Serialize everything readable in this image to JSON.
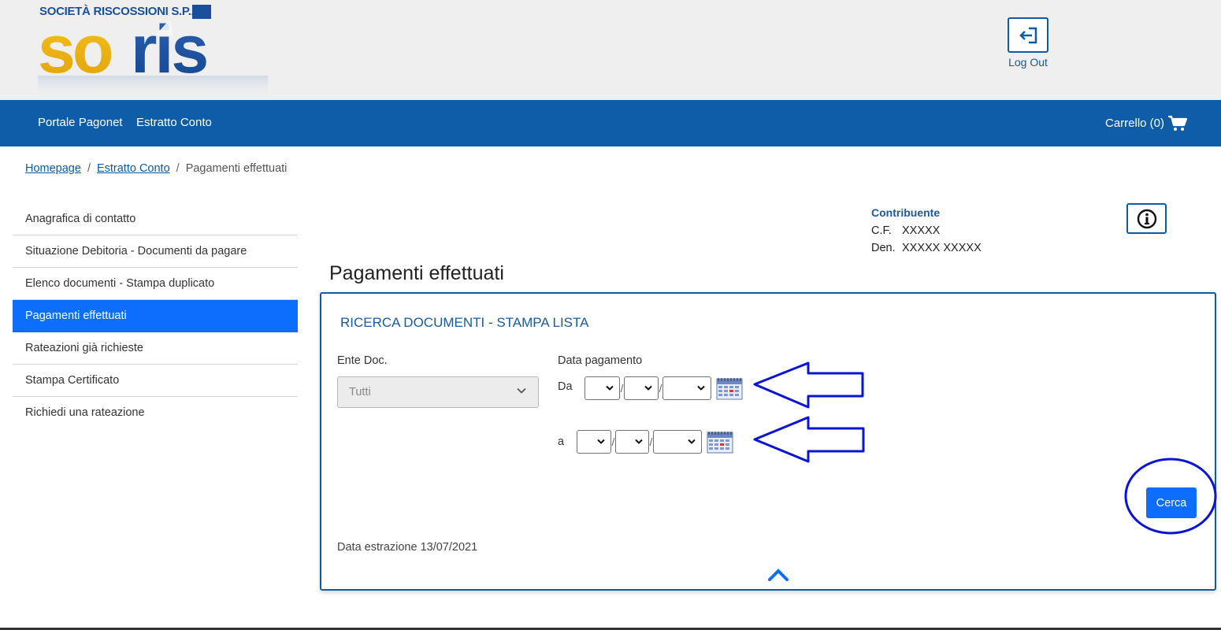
{
  "header": {
    "company_caption": "SOCIETÀ RISCOSSIONI S.P.A.",
    "brand_text": "soris",
    "logout_label": "Log Out"
  },
  "nav": {
    "links": [
      "Portale Pagonet",
      "Estratto Conto"
    ],
    "cart_label": "Carrello (0)"
  },
  "breadcrumb": {
    "items": [
      "Homepage",
      "Estratto Conto"
    ],
    "current": "Pagamenti effettuati"
  },
  "sidebar": {
    "items": [
      {
        "label": "Anagrafica di contatto"
      },
      {
        "label": "Situazione Debitoria - Documenti da pagare"
      },
      {
        "label": "Elenco documenti - Stampa duplicato"
      },
      {
        "label": "Pagamenti effettuati"
      },
      {
        "label": "Rateazioni già richieste"
      },
      {
        "label": "Stampa Certificato"
      },
      {
        "label": "Richiedi una rateazione"
      }
    ],
    "active": "Pagamenti effettuati"
  },
  "contribuente": {
    "title": "Contribuente",
    "cf_label": "C.F.",
    "cf_value": "XXXXX",
    "den_label": "Den.",
    "den_value": "XXXXX XXXXX"
  },
  "page": {
    "title": "Pagamenti effettuati"
  },
  "search": {
    "panel_title": "RICERCA DOCUMENTI - STAMPA LISTA",
    "ente_label": "Ente Doc.",
    "ente_value": "Tutti",
    "date_label": "Data pagamento",
    "from_label": "Da",
    "to_label": "a",
    "search_button": "Cerca",
    "extraction": "Data estrazione 13/07/2021"
  },
  "colors": {
    "brand_blue": "#0f5da8",
    "accent_blue": "#0d6efd",
    "annotation_blue": "#0a14d6",
    "logo_yellow": "#f2b20c"
  }
}
